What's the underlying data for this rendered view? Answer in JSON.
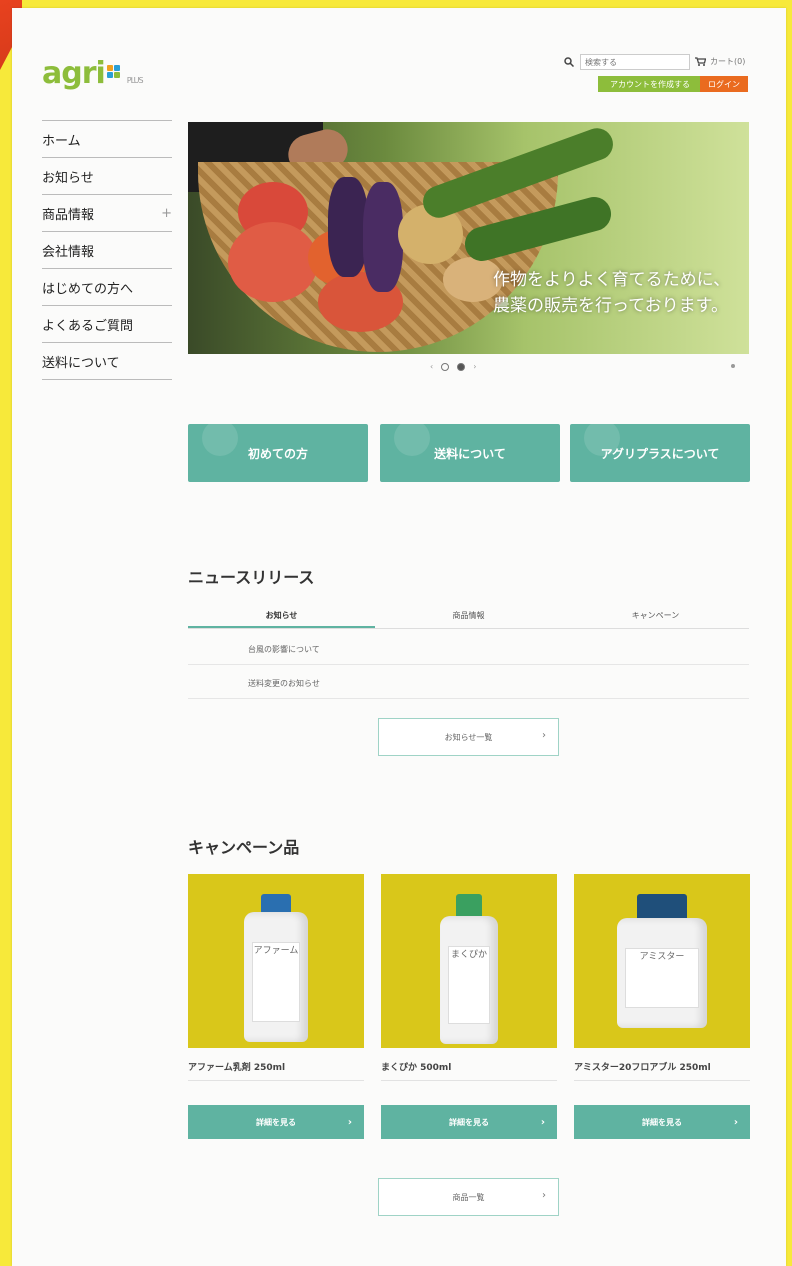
{
  "header": {
    "logo_text": "agri",
    "logo_suffix": "PLUS",
    "search_placeholder": "検索する",
    "cart_label": "カート(0)",
    "create_account": "アカウントを作成する",
    "login": "ログイン"
  },
  "sidebar": {
    "items": [
      {
        "label": "ホーム"
      },
      {
        "label": "お知らせ"
      },
      {
        "label": "商品情報",
        "expand": "+"
      },
      {
        "label": "会社情報"
      },
      {
        "label": "はじめての方へ"
      },
      {
        "label": "よくあるご質問"
      },
      {
        "label": "送料について"
      }
    ]
  },
  "hero": {
    "caption_line1": "作物をよりよく育てるために、",
    "caption_line2": "農薬の販売を行っております。",
    "prev": "‹",
    "next": "›"
  },
  "features": [
    {
      "label": "初めての方"
    },
    {
      "label": "送料について"
    },
    {
      "label": "アグリプラスについて"
    }
  ],
  "news": {
    "title": "ニュースリリース",
    "tabs": [
      "お知らせ",
      "商品情報",
      "キャンペーン"
    ],
    "items": [
      "台風の影響について",
      "送料変更のお知らせ"
    ],
    "more": "お知らせ一覧"
  },
  "campaign": {
    "title": "キャンペーン品",
    "products": [
      {
        "name": "アファーム乳剤 250ml",
        "label": "アファーム",
        "cap_color": "#2a6fb0",
        "detail": "詳細を見る"
      },
      {
        "name": "まくぴか 500ml",
        "label": "まくぴか",
        "cap_color": "#3aa060",
        "detail": "詳細を見る"
      },
      {
        "name": "アミスター20フロアブル 250ml",
        "label": "アミスター",
        "cap_color": "#1f4f7a",
        "detail": "詳細を見る"
      }
    ],
    "more": "商品一覧"
  },
  "colors": {
    "accent": "#5fb3a1",
    "brand_green": "#8dbd3b",
    "login_orange": "#ea6b1f",
    "product_bg": "#d9c71a",
    "page_border": "#f7e93a"
  }
}
